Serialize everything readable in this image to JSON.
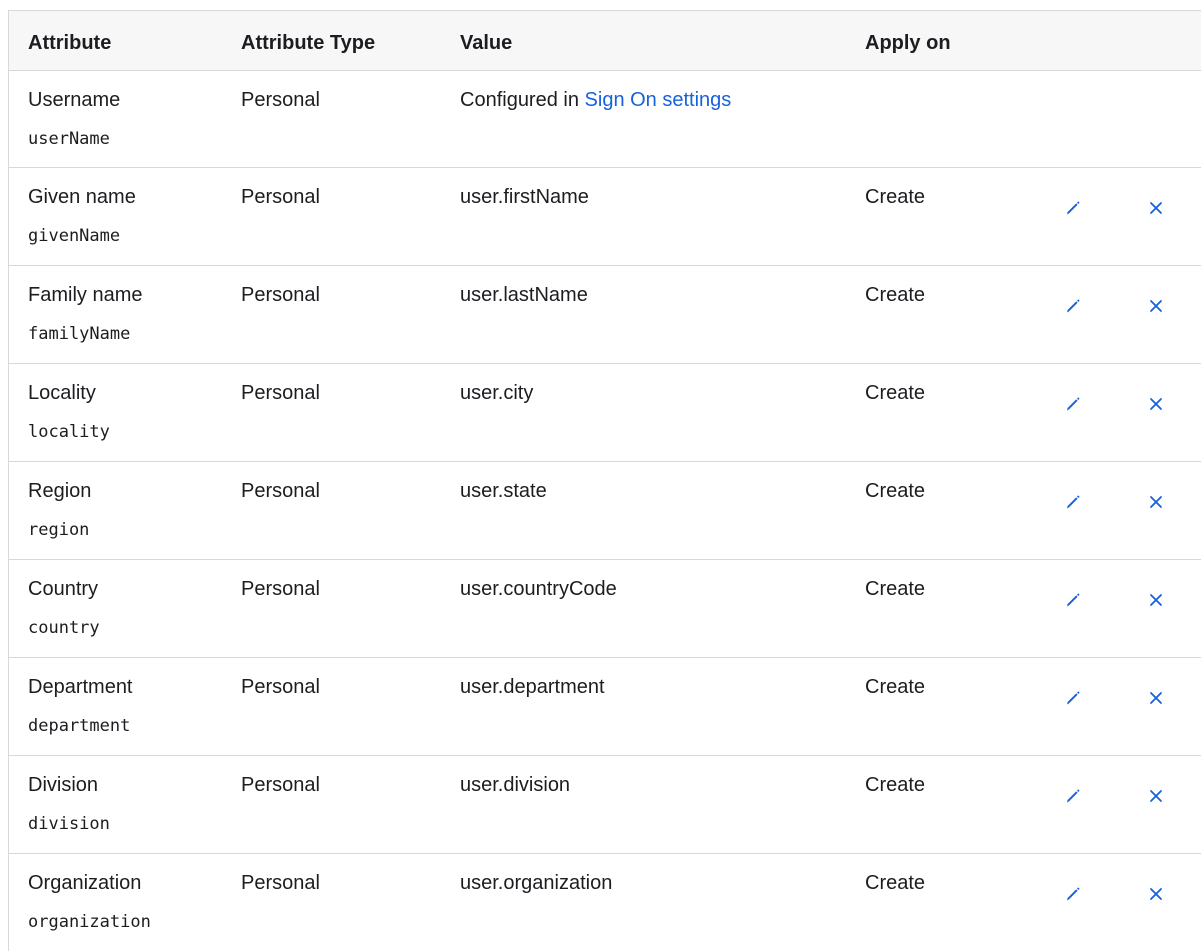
{
  "table": {
    "headers": {
      "attribute": "Attribute",
      "attribute_type": "Attribute Type",
      "value": "Value",
      "apply_on": "Apply on"
    },
    "rows": [
      {
        "label": "Username",
        "key": "userName",
        "type": "Personal",
        "value_prefix": "Configured in",
        "value_link": "Sign On settings",
        "apply_on": "",
        "editable": false
      },
      {
        "label": "Given name",
        "key": "givenName",
        "type": "Personal",
        "value": "user.firstName",
        "apply_on": "Create",
        "editable": true
      },
      {
        "label": "Family name",
        "key": "familyName",
        "type": "Personal",
        "value": "user.lastName",
        "apply_on": "Create",
        "editable": true
      },
      {
        "label": "Locality",
        "key": "locality",
        "type": "Personal",
        "value": "user.city",
        "apply_on": "Create",
        "editable": true
      },
      {
        "label": "Region",
        "key": "region",
        "type": "Personal",
        "value": "user.state",
        "apply_on": "Create",
        "editable": true
      },
      {
        "label": "Country",
        "key": "country",
        "type": "Personal",
        "value": "user.countryCode",
        "apply_on": "Create",
        "editable": true
      },
      {
        "label": "Department",
        "key": "department",
        "type": "Personal",
        "value": "user.department",
        "apply_on": "Create",
        "editable": true
      },
      {
        "label": "Division",
        "key": "division",
        "type": "Personal",
        "value": "user.division",
        "apply_on": "Create",
        "editable": true
      },
      {
        "label": "Organization",
        "key": "organization",
        "type": "Personal",
        "value": "user.organization",
        "apply_on": "Create",
        "editable": true
      }
    ]
  },
  "icons": {
    "edit": "pencil-icon",
    "delete": "close-icon"
  },
  "colors": {
    "accent": "#1662dd",
    "border": "#d7d7dc",
    "header_bg": "#f7f7f8",
    "text": "#1d1d21"
  }
}
